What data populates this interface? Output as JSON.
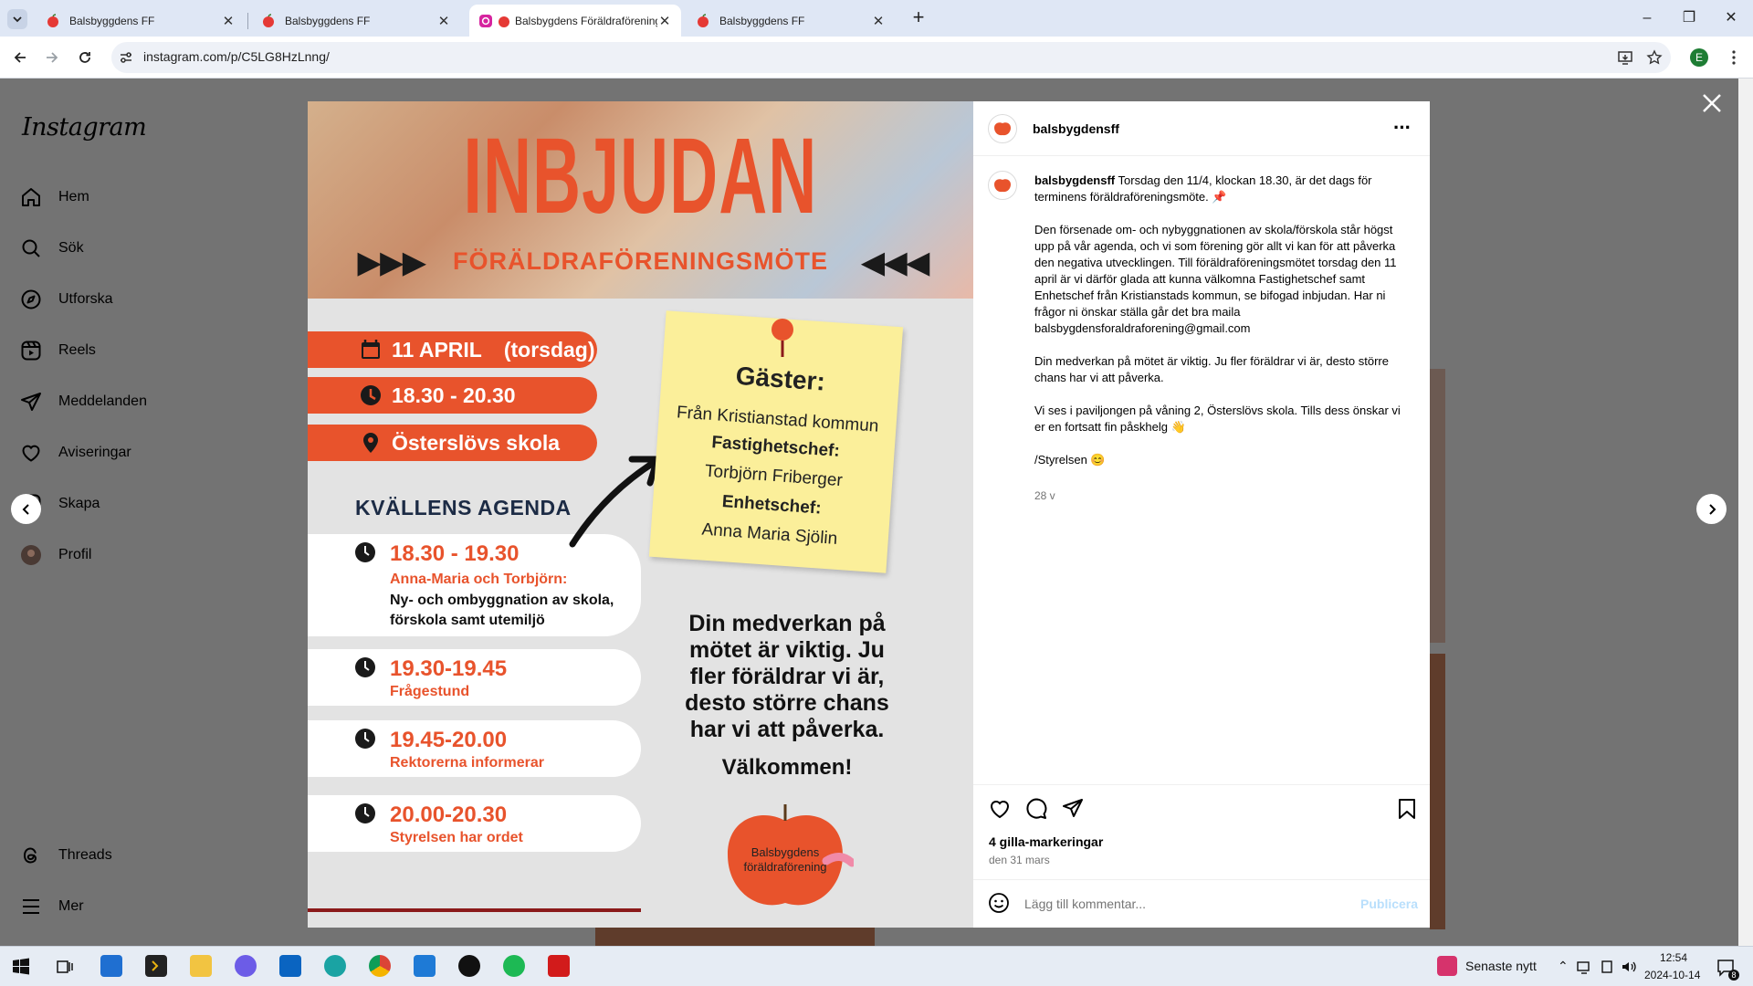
{
  "browser": {
    "tabs": [
      {
        "title": "Balsbyggdens FF",
        "active": false
      },
      {
        "title": "Balsbyggdens FF",
        "active": false
      },
      {
        "title": "Balsbygdens Föräldraförening",
        "active": true
      },
      {
        "title": "Balsbyggdens FF",
        "active": false
      }
    ],
    "url": "instagram.com/p/C5LG8HzLnng/",
    "profile_initial": "E"
  },
  "instagram": {
    "logo": "Instagram",
    "nav": [
      {
        "label": "Hem",
        "icon": "home-icon"
      },
      {
        "label": "Sök",
        "icon": "search-icon"
      },
      {
        "label": "Utforska",
        "icon": "explore-icon"
      },
      {
        "label": "Reels",
        "icon": "reels-icon"
      },
      {
        "label": "Meddelanden",
        "icon": "messages-icon"
      },
      {
        "label": "Aviseringar",
        "icon": "heart-icon"
      },
      {
        "label": "Skapa",
        "icon": "create-icon"
      },
      {
        "label": "Profil",
        "icon": "profile-icon"
      }
    ],
    "nav_bottom": [
      {
        "label": "Threads",
        "icon": "threads-icon"
      },
      {
        "label": "Mer",
        "icon": "menu-icon"
      }
    ]
  },
  "poster": {
    "title": "INBJUDAN",
    "subtitle": "FÖRÄLDRAFÖRENINGSMÖTE",
    "arrows_left": "▶▶▶",
    "arrows_right": "◀◀◀",
    "date_day": "11 APRIL",
    "date_weekday": "(torsdag)",
    "time": "18.30 - 20.30",
    "place": "Österslövs skola",
    "agenda_heading": "KVÄLLENS AGENDA",
    "agenda": [
      {
        "time": "18.30 - 19.30",
        "who": "Anna-Maria och Torbjörn:",
        "desc": "Ny- och ombyggnation av skola, förskola samt utemiljö"
      },
      {
        "time": "19.30-19.45",
        "who": "Frågestund",
        "desc": ""
      },
      {
        "time": "19.45-20.00",
        "who": "Rektorerna informerar",
        "desc": ""
      },
      {
        "time": "20.00-20.30",
        "who": "Styrelsen har ordet",
        "desc": ""
      }
    ],
    "note": {
      "heading": "Gäster:",
      "line1": "Från Kristianstad kommun",
      "role1": "Fastighetschef:",
      "name1": "Torbjörn Friberger",
      "role2": "Enhetschef:",
      "name2": "Anna Maria Sjölin"
    },
    "bigtext": "Din medverkan på mötet är viktig. Ju fler föräldrar vi är, desto större chans har vi att påverka.",
    "welcome": "Välkommen!",
    "logo_text": "Balsbygdens föräldraförening"
  },
  "post": {
    "username": "balsbygdensff",
    "caption_first": "Torsdag den 11/4, klockan 18.30, är det dags för terminens föräldraföreningsmöte. 📌",
    "caption_p2": "Den försenade om- och nybyggnationen av skola/förskola står högst upp på vår agenda, och vi som förening gör allt vi kan för att påverka den negativa utvecklingen. Till föräldraföreningsmötet torsdag den 11 april är vi därför glada att kunna välkomna Fastighetschef samt Enhetschef från Kristianstads kommun, se bifogad inbjudan. Har ni frågor ni önskar ställa går det bra maila balsbygdensforaldraforening@gmail.com",
    "caption_p3": "Din medverkan på mötet är viktig. Ju fler föräldrar vi är, desto större chans har vi att påverka.",
    "caption_p4": "Vi ses i paviljongen på våning 2, Österslövs skola. Tills dess önskar vi er en fortsatt fin påskhelg 👋",
    "caption_p5": "/Styrelsen 😊",
    "age": "28 v",
    "likes": "4 gilla-markeringar",
    "date": "den 31 mars",
    "comment_placeholder": "Lägg till kommentar...",
    "publish": "Publicera",
    "more": "···"
  },
  "taskbar": {
    "news": "Senaste nytt",
    "time": "12:54",
    "date": "2024-10-14",
    "notifications": "8"
  },
  "colors": {
    "accent": "#e8532c",
    "navy": "#1c2b45",
    "note": "#fbef9a"
  }
}
